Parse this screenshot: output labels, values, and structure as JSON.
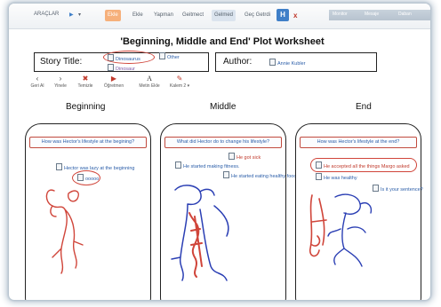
{
  "toolbar": {
    "menu": "ARAÇLAR",
    "tabs": [
      "Ekle",
      "Ekle",
      "Yapman",
      "Geitmect",
      "Gelmed",
      "Geç Getrdi"
    ],
    "close_label": "x",
    "help_label": "H",
    "right_items": [
      "Monitor",
      "Mesaje",
      "Daban"
    ]
  },
  "worksheet": {
    "title": "'Beginning, Middle and End' Plot Worksheet",
    "story_title_label": "Story Title:",
    "author_label": "Author:",
    "story_title_note": "Dinosaurus",
    "story_title_note_2": "Dinosaur",
    "story_title_note_3": "Other",
    "author_note": "Annie Kubler"
  },
  "tools": [
    {
      "icon": "back-arrow-icon",
      "glyph": "‹",
      "label": "Geri Al"
    },
    {
      "icon": "forward-arrow-icon",
      "glyph": "›",
      "label": "Yinele"
    },
    {
      "icon": "delete-icon",
      "glyph": "✖",
      "label": "Temizle"
    },
    {
      "icon": "teacher-icon",
      "glyph": "▶",
      "label": "Öğretmen"
    },
    {
      "icon": "text-icon",
      "glyph": "A",
      "label": "Metin Ekle"
    },
    {
      "icon": "pen-icon",
      "glyph": "✎",
      "label": "Kalem 2 ▾"
    }
  ],
  "columns": {
    "beginning": "Beginning",
    "middle": "Middle",
    "end": "End"
  },
  "panels": {
    "beginning": {
      "question": "How was Hector's lifestyle at the begining?",
      "notes": [
        "Hector was lazy at the beginning",
        "ooooo"
      ]
    },
    "middle": {
      "question": "What did Hector do to change his lifestyle?",
      "notes": [
        "He got sick",
        "He started making fitness.",
        "He started eating healthy food."
      ]
    },
    "end": {
      "question": "How was Hector's lifestyle at the end?",
      "notes": [
        "He accepted all the things Margo asked",
        "He was healthy",
        "Is it your sentence?"
      ]
    }
  },
  "colors": {
    "accent": "#f6b07b",
    "note_blue": "#2a5da8",
    "marker_red": "#d0453a",
    "marker_blue": "#2b3fb4"
  }
}
